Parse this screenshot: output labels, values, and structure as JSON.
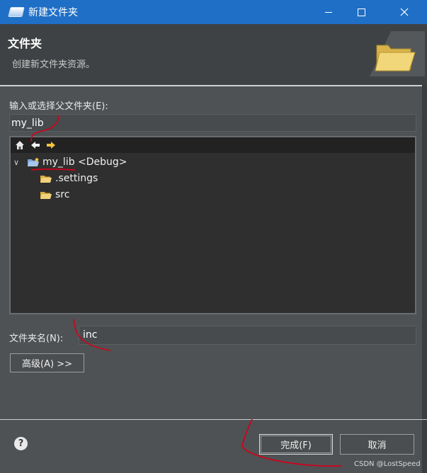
{
  "window": {
    "title": "新建文件夹"
  },
  "header": {
    "title": "文件夹",
    "description": "创建新文件夹资源。"
  },
  "parent_folder": {
    "label": "输入或选择父文件夹(E):",
    "value": "my_lib"
  },
  "tree": {
    "toolbar_icons": [
      "home-icon",
      "back-arrow-icon",
      "forward-arrow-icon"
    ],
    "root": {
      "label": "my_lib <Debug>",
      "expanded": true
    },
    "children": [
      {
        "label": ".settings"
      },
      {
        "label": "src"
      }
    ]
  },
  "folder_name": {
    "label": "文件夹名(N):",
    "value": "inc"
  },
  "advanced_button": {
    "label": "高级(A) >>"
  },
  "footer": {
    "finish_label": "完成(F)",
    "cancel_label": "取消"
  },
  "watermark": "CSDN @LostSpeed",
  "colors": {
    "titlebar": "#1f6fc6",
    "dialog_bg": "#4f5254",
    "header_bg": "#3f4244",
    "tree_bg": "#2f2f2f",
    "folder_yellow": "#f0c43c",
    "annotation_red": "#d0021b"
  }
}
